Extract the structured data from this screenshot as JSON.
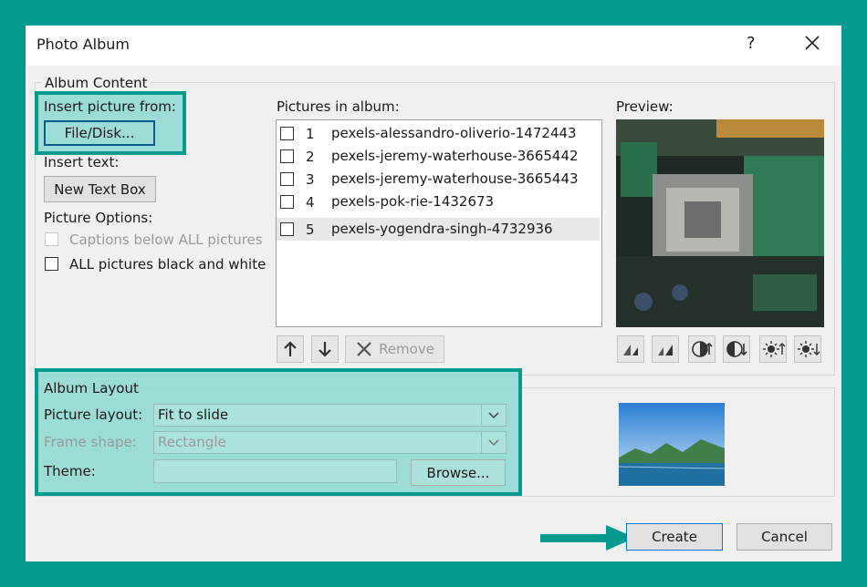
{
  "dialog": {
    "title": "Photo Album",
    "help": "?"
  },
  "album_content": {
    "label": "Album Content",
    "insert_picture_from": "Insert picture from:",
    "file_disk_button": "File/Disk...",
    "insert_text": "Insert text:",
    "new_text_box_button": "New Text Box",
    "picture_options": "Picture Options:",
    "captions_option": "Captions below ALL pictures",
    "bw_option": "ALL pictures black and white"
  },
  "pictures": {
    "label": "Pictures in album:",
    "items": [
      {
        "num": "1",
        "name": "pexels-alessandro-oliverio-1472443"
      },
      {
        "num": "2",
        "name": "pexels-jeremy-waterhouse-3665442"
      },
      {
        "num": "3",
        "name": "pexels-jeremy-waterhouse-3665443"
      },
      {
        "num": "4",
        "name": "pexels-pok-rie-1432673"
      },
      {
        "num": "5",
        "name": "pexels-yogendra-singh-4732936"
      }
    ],
    "remove_button": "Remove"
  },
  "preview": {
    "label": "Preview:"
  },
  "album_layout": {
    "label": "Album Layout",
    "picture_layout_label": "Picture layout:",
    "picture_layout_value": "Fit to slide",
    "frame_shape_label": "Frame shape:",
    "frame_shape_value": "Rectangle",
    "theme_label": "Theme:",
    "theme_value": "",
    "browse_button": "Browse..."
  },
  "footer": {
    "create_button": "Create",
    "cancel_button": "Cancel"
  },
  "colors": {
    "accent": "#069a8e",
    "highlight": "#7fd6cd"
  }
}
